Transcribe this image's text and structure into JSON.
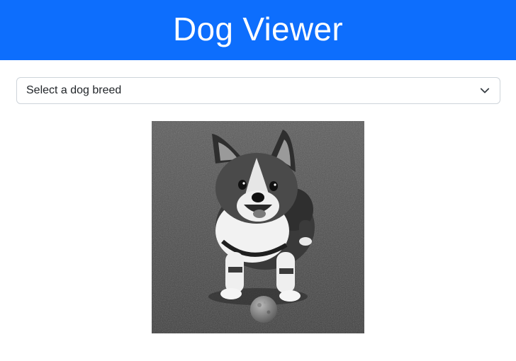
{
  "header": {
    "title": "Dog Viewer",
    "background_color": "#0d6efd",
    "text_color": "#ffffff"
  },
  "breed_select": {
    "selected_value": "Select a dog breed",
    "icon": "chevron-down-icon"
  },
  "dog_image": {
    "description_icon": "corgi-photo",
    "style": "grayscale"
  }
}
